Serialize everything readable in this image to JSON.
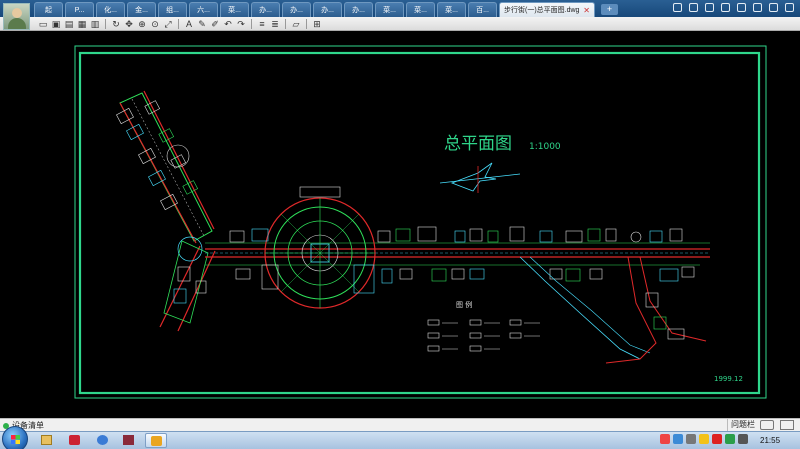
{
  "tabs": [
    {
      "label": "起"
    },
    {
      "label": "P..."
    },
    {
      "label": "化..."
    },
    {
      "label": "金..."
    },
    {
      "label": "组..."
    },
    {
      "label": "六..."
    },
    {
      "label": "菜..."
    },
    {
      "label": "办..."
    },
    {
      "label": "办..."
    },
    {
      "label": "办..."
    },
    {
      "label": "办..."
    },
    {
      "label": "菜..."
    },
    {
      "label": "菜..."
    },
    {
      "label": "菜..."
    },
    {
      "label": "百..."
    }
  ],
  "active_tab": {
    "label": "步行街(一)总平面图.dwg",
    "close": "✕"
  },
  "new_tab": "+",
  "drawing": {
    "title": "总平面图",
    "scale": "1:1000",
    "legend_title": "图    例",
    "date": "1999.12",
    "colors": {
      "frame": "#2fd78c",
      "red": "#e0292a",
      "green": "#2fe05a",
      "cyan": "#48e0ff",
      "white": "#dddddd",
      "title": "#2fd58a"
    }
  },
  "status": {
    "left_label": "设备清单",
    "feedback": "问题栏"
  },
  "clock": "21:55"
}
